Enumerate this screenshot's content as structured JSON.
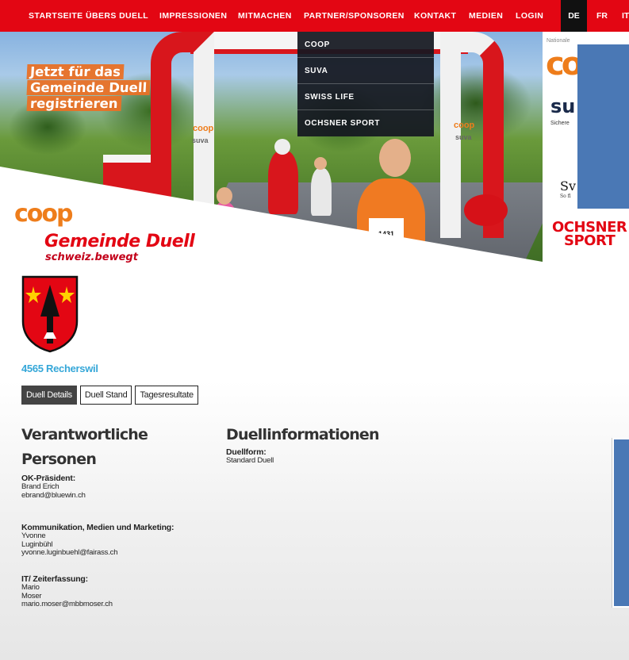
{
  "nav": {
    "items": [
      "STARTSEITE",
      "ÜBERS DUELL",
      "IMPRESSIONEN",
      "MITMACHEN",
      "PARTNER/SPONSOREN",
      "KONTAKT",
      "MEDIEN",
      "LOGIN"
    ],
    "languages": [
      "DE",
      "FR",
      "IT"
    ],
    "active_language": "DE"
  },
  "dropdown": {
    "items": [
      "COOP",
      "SUVA",
      "SWISS LIFE",
      "OCHSNER SPORT"
    ]
  },
  "hero": {
    "promo_lines": [
      "Jetzt für das",
      "Gemeinde Duell",
      "registrieren"
    ],
    "logo_coop": "coop",
    "logo_title": "Gemeinde Duell",
    "logo_subtitle": "schweiz.bewegt",
    "arch_label_coop": "coop",
    "arch_label_suva": "suva",
    "bib_number": "1431"
  },
  "sponsors": {
    "small_label": "Nationale",
    "coop_partial": "co",
    "suva_partial": "su",
    "suva_tagline": "Sichere",
    "swisslife_partial": "Sv",
    "swisslife_tagline": "So fl",
    "ochsner_line1": "OCHSNER",
    "ochsner_line2": "SPORT"
  },
  "municipality": {
    "name": "4565 Recherswil"
  },
  "tabs": [
    {
      "label": "Duell Details",
      "active": true
    },
    {
      "label": "Duell Stand",
      "active": false
    },
    {
      "label": "Tagesresultate",
      "active": false
    }
  ],
  "contacts": {
    "title_line1": "Verantwortliche",
    "title_line2": "Personen",
    "entries": [
      {
        "role": "OK-Präsident:",
        "lines": [
          "Brand Erich",
          "ebrand@bluewin.ch"
        ]
      },
      {
        "role": "Kommunikation, Medien und Marketing:",
        "lines": [
          "Yvonne",
          "Luginbühl",
          "yvonne.luginbuehl@fairass.ch"
        ]
      },
      {
        "role": "IT/ Zeiterfassung:",
        "lines": [
          "Mario",
          "Moser",
          "mario.moser@mbbmoser.ch"
        ]
      }
    ]
  },
  "duel_info": {
    "title": "Duellinformationen",
    "form_label": "Duellform:",
    "form_value": "Standard Duell"
  },
  "colors": {
    "brand_red": "#e30613",
    "coop_orange": "#ee7d1b",
    "link_blue": "#35a7d8",
    "sidebar_blue": "#4a78b5"
  }
}
